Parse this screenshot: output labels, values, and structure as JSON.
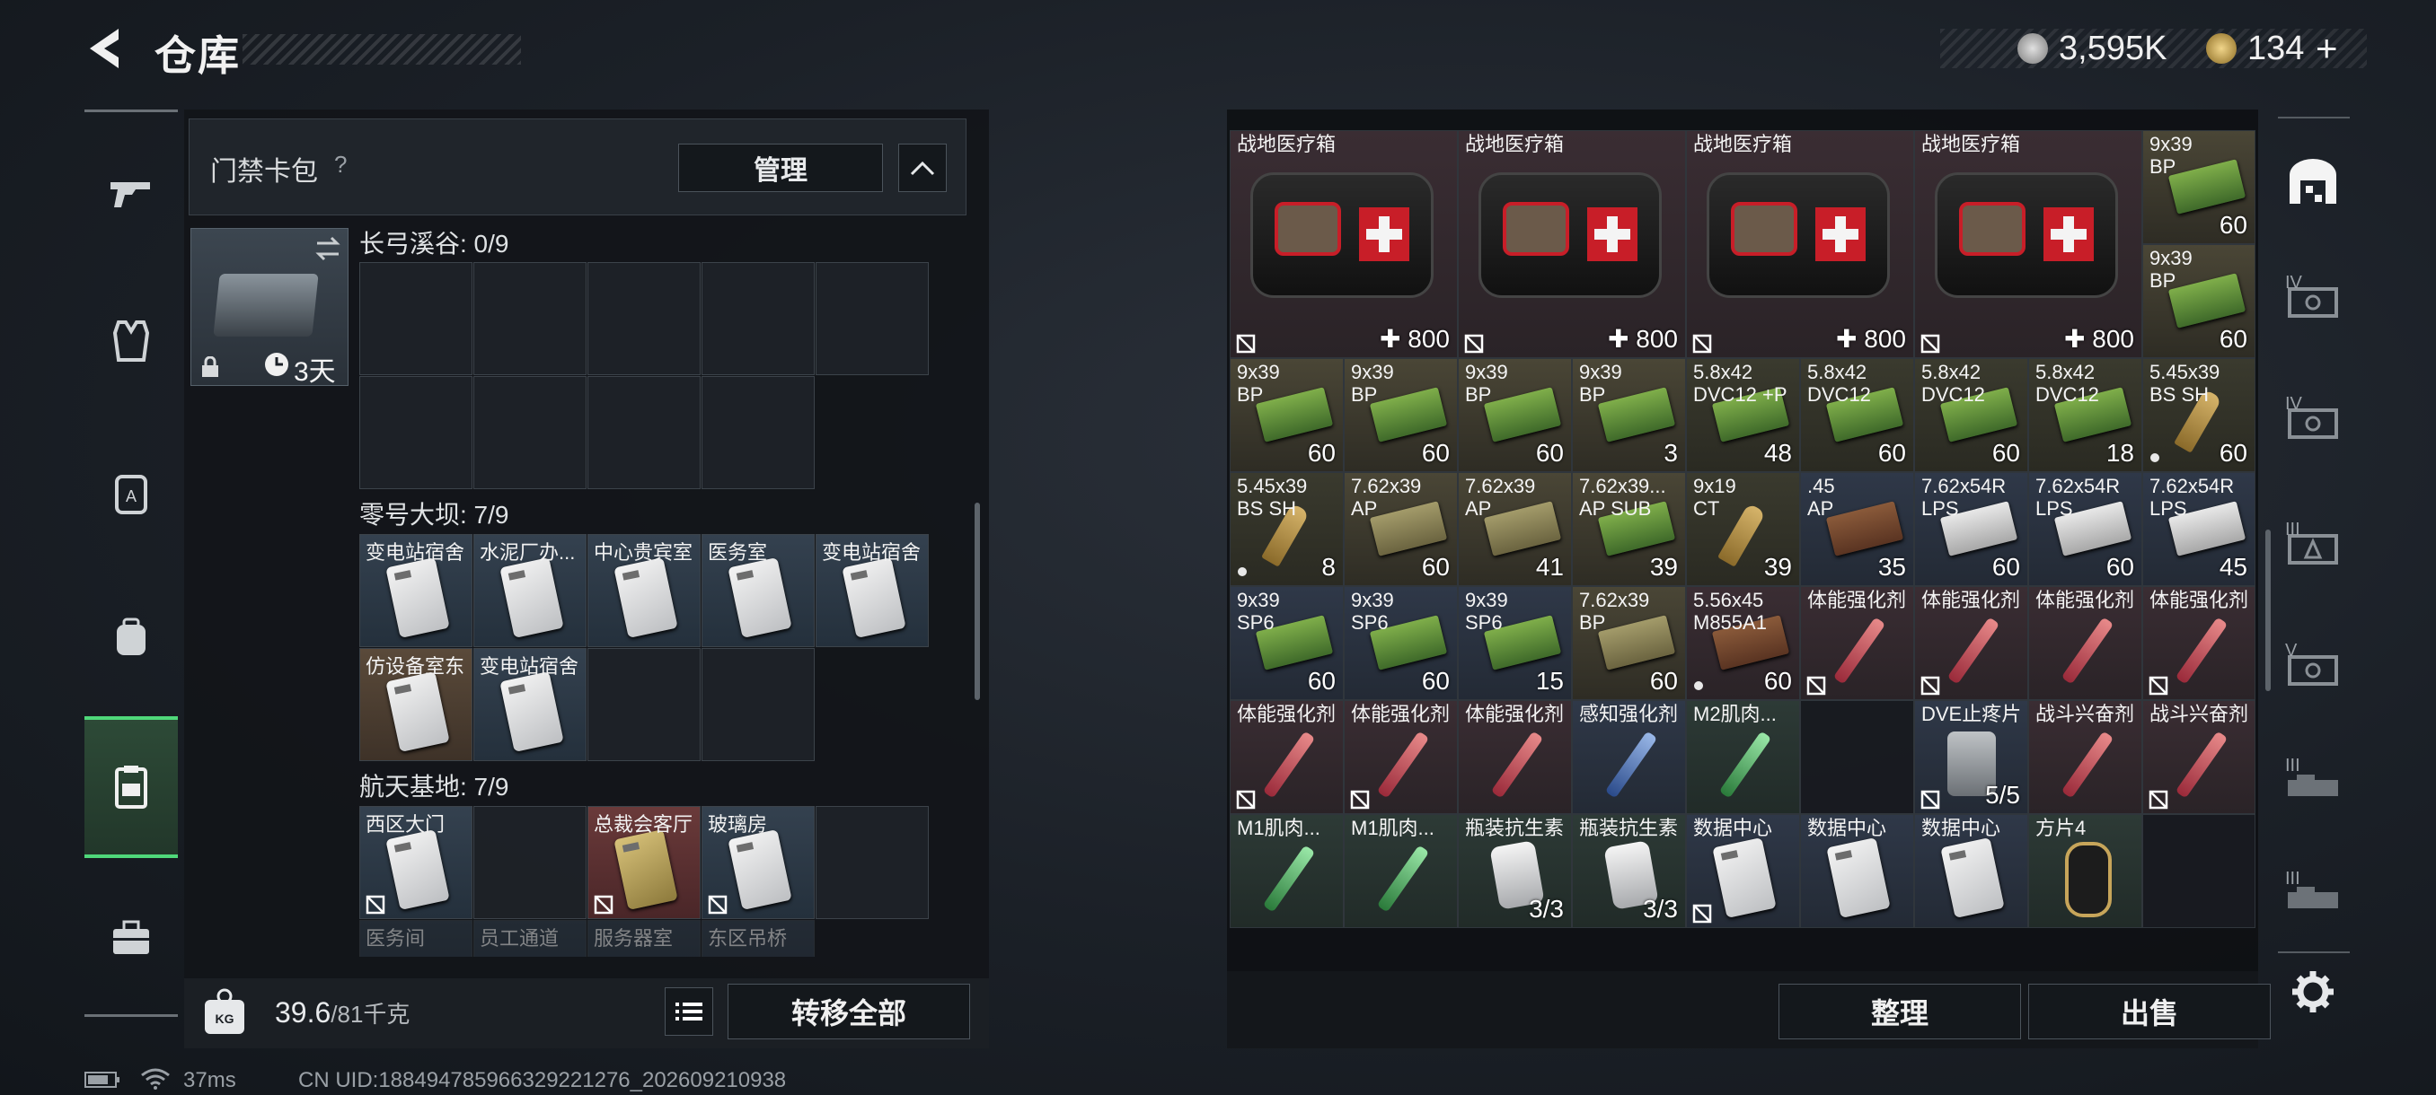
{
  "header": {
    "title": "仓库"
  },
  "currency": [
    {
      "icon": "silver-coin-icon",
      "value": "3,595K"
    },
    {
      "icon": "gold-coin-icon",
      "value": "134"
    }
  ],
  "currency_add": "+",
  "keycard_pack": {
    "title": "门禁卡包",
    "help": "?",
    "manage_label": "管理",
    "thumb_time": "3天"
  },
  "sections": [
    {
      "label": "长弓溪谷: 0/9"
    },
    {
      "label": "零号大坝: 7/9",
      "cards": [
        "变电站宿舍",
        "水泥厂办...",
        "中心贵宾室",
        "医务室",
        "变电站宿舍",
        "仿设备室东",
        "变电站宿舍"
      ]
    },
    {
      "label": "航天基地: 7/9",
      "cards": [
        "西区大门",
        "总裁会客厅",
        "玻璃房",
        "医务间",
        "员工通道",
        "服务器室",
        "东区吊桥"
      ]
    }
  ],
  "weight": {
    "current": "39.6",
    "max": "/81千克"
  },
  "transfer_all": "转移全部",
  "status": {
    "ping": "37ms",
    "uid": "CN UID:1884947859663292​21276_202609210938"
  },
  "inventory": {
    "medkits": [
      {
        "name": "战地医疗箱",
        "count": "800"
      },
      {
        "name": "战地医疗箱",
        "count": "800"
      },
      {
        "name": "战地医疗箱",
        "count": "800"
      },
      {
        "name": "战地医疗箱",
        "count": "800"
      }
    ],
    "side_col": [
      {
        "name": "9x39\nBP",
        "count": "60"
      },
      {
        "name": "9x39\nBP",
        "count": "60"
      }
    ],
    "row1": [
      {
        "name": "9x39\nBP",
        "count": "60"
      },
      {
        "name": "9x39\nBP",
        "count": "60"
      },
      {
        "name": "9x39\nBP",
        "count": "60"
      },
      {
        "name": "9x39\nBP",
        "count": "3"
      },
      {
        "name": "5.8x42\nDVC12 +P",
        "count": "48"
      },
      {
        "name": "5.8x42\nDVC12",
        "count": "60"
      },
      {
        "name": "5.8x42\nDVC12",
        "count": "60"
      },
      {
        "name": "5.8x42\nDVC12",
        "count": "18"
      },
      {
        "name": "5.45x39\nBS SH",
        "count": "60"
      }
    ],
    "row2": [
      {
        "name": "5.45x39\nBS SH",
        "count": "8"
      },
      {
        "name": "7.62x39\nAP",
        "count": "60"
      },
      {
        "name": "7.62x39\nAP",
        "count": "41"
      },
      {
        "name": "7.62x39...\nAP SUB",
        "count": "39"
      },
      {
        "name": "9x19\nCT",
        "count": "39"
      },
      {
        "name": ".45\nAP",
        "count": "35"
      },
      {
        "name": "7.62x54R\nLPS",
        "count": "60"
      },
      {
        "name": "7.62x54R\nLPS",
        "count": "60"
      },
      {
        "name": "7.62x54R\nLPS",
        "count": "45"
      }
    ],
    "row3": [
      {
        "name": "9x39\nSP6",
        "count": "60"
      },
      {
        "name": "9x39\nSP6",
        "count": "60"
      },
      {
        "name": "9x39\nSP6",
        "count": "15"
      },
      {
        "name": "7.62x39\nBP",
        "count": "60"
      },
      {
        "name": "5.56x45\nM855A1",
        "count": "60"
      },
      {
        "name": "体能强化剂",
        "count": ""
      },
      {
        "name": "体能强化剂",
        "count": ""
      },
      {
        "name": "体能强化剂",
        "count": ""
      },
      {
        "name": "体能强化剂",
        "count": ""
      }
    ],
    "row4": [
      {
        "name": "体能强化剂",
        "count": ""
      },
      {
        "name": "体能强化剂",
        "count": ""
      },
      {
        "name": "体能强化剂",
        "count": ""
      },
      {
        "name": "感知强化剂",
        "count": ""
      },
      {
        "name": "M2肌肉...",
        "count": ""
      },
      {
        "name": "",
        "count": ""
      },
      {
        "name": "DVE止疼片",
        "count": "5/5"
      },
      {
        "name": "战斗兴奋剂",
        "count": ""
      },
      {
        "name": "战斗兴奋剂",
        "count": ""
      }
    ],
    "row5": [
      {
        "name": "M1肌肉...",
        "count": ""
      },
      {
        "name": "M1肌肉...",
        "count": ""
      },
      {
        "name": "瓶装抗生素",
        "count": "3/3"
      },
      {
        "name": "瓶装抗生素",
        "count": "3/3"
      },
      {
        "name": "数据中心",
        "count": ""
      },
      {
        "name": "数据中心",
        "count": ""
      },
      {
        "name": "数据中心",
        "count": ""
      },
      {
        "name": "方片4",
        "count": ""
      },
      {
        "name": "",
        "count": ""
      }
    ]
  },
  "sort_label": "整理",
  "sell_label": "出售",
  "rail": [
    "IV",
    "IV",
    "III",
    "V",
    "III",
    "III"
  ],
  "colors": {
    "accent": "#4fd87a",
    "panel": "#1b1f24"
  }
}
